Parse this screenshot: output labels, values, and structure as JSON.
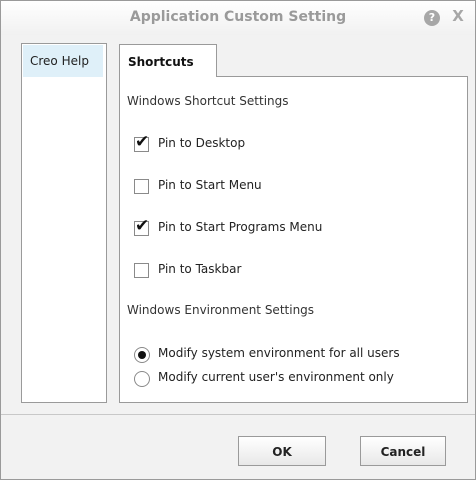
{
  "window": {
    "title": "Application Custom Setting",
    "help_icon": "?",
    "close_icon": "X"
  },
  "sidebar": {
    "items": [
      {
        "label": "Creo Help",
        "selected": true
      }
    ]
  },
  "tabs": [
    {
      "label": "Shortcuts",
      "active": true
    }
  ],
  "shortcuts": {
    "section_title": "Windows Shortcut Settings",
    "options": [
      {
        "label": "Pin to Desktop",
        "checked": true
      },
      {
        "label": "Pin to Start Menu",
        "checked": false
      },
      {
        "label": "Pin to Start Programs Menu",
        "checked": true
      },
      {
        "label": "Pin to Taskbar",
        "checked": false
      }
    ]
  },
  "environment": {
    "section_title": "Windows Environment Settings",
    "options": [
      {
        "label": "Modify system environment for all users",
        "selected": true
      },
      {
        "label": "Modify current user's environment only",
        "selected": false
      }
    ]
  },
  "buttons": {
    "ok_label": "OK",
    "cancel_label": "Cancel"
  }
}
